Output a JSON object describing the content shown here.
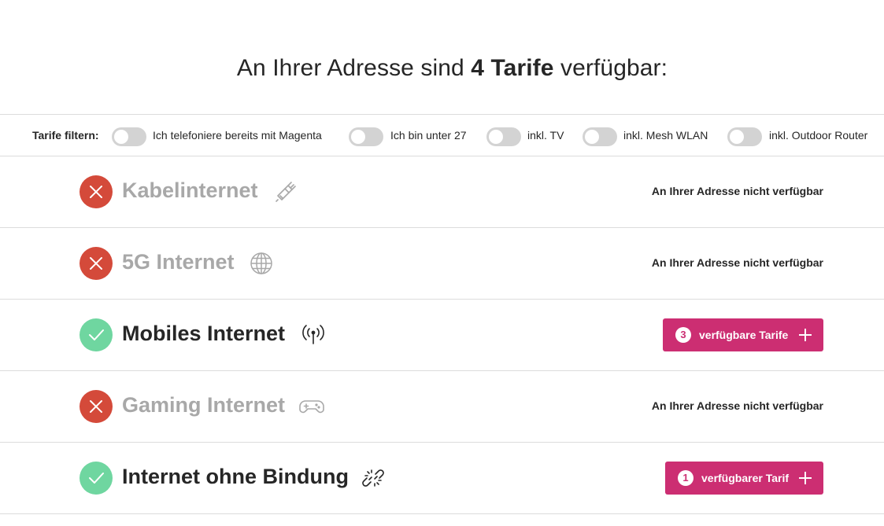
{
  "headline": {
    "prefix": "An Ihrer Adresse sind ",
    "bold": "4 Tarife",
    "suffix": " verfügbar:"
  },
  "filters": {
    "label": "Tarife filtern:",
    "toggles": [
      {
        "label": "Ich telefoniere bereits mit Magenta",
        "on": false
      },
      {
        "label": "Ich bin unter 27",
        "on": false
      },
      {
        "label": "inkl. TV",
        "on": false
      },
      {
        "label": "inkl. Mesh WLAN",
        "on": false
      },
      {
        "label": "inkl. Outdoor Router",
        "on": false
      }
    ]
  },
  "rows": [
    {
      "title": "Kabelinternet",
      "available": false,
      "icon": "cable-plug-icon",
      "status_text": "An Ihrer Adresse nicht verfügbar"
    },
    {
      "title": "5G Internet",
      "available": false,
      "icon": "globe-icon",
      "status_text": "An Ihrer Adresse nicht verfügbar"
    },
    {
      "title": "Mobiles Internet",
      "available": true,
      "icon": "antenna-icon",
      "button_count": "3",
      "button_label": "verfügbare Tarife"
    },
    {
      "title": "Gaming Internet",
      "available": false,
      "icon": "gamepad-icon",
      "status_text": "An Ihrer Adresse nicht verfügbar"
    },
    {
      "title": "Internet ohne Bindung",
      "available": true,
      "icon": "broken-link-icon",
      "button_count": "1",
      "button_label": "verfügbarer Tarif"
    }
  ],
  "colors": {
    "brand_magenta": "#cc2e72",
    "unavailable_red": "#d44a3a",
    "available_green": "#6fd6a0",
    "toggle_off": "#d3d3d3"
  }
}
